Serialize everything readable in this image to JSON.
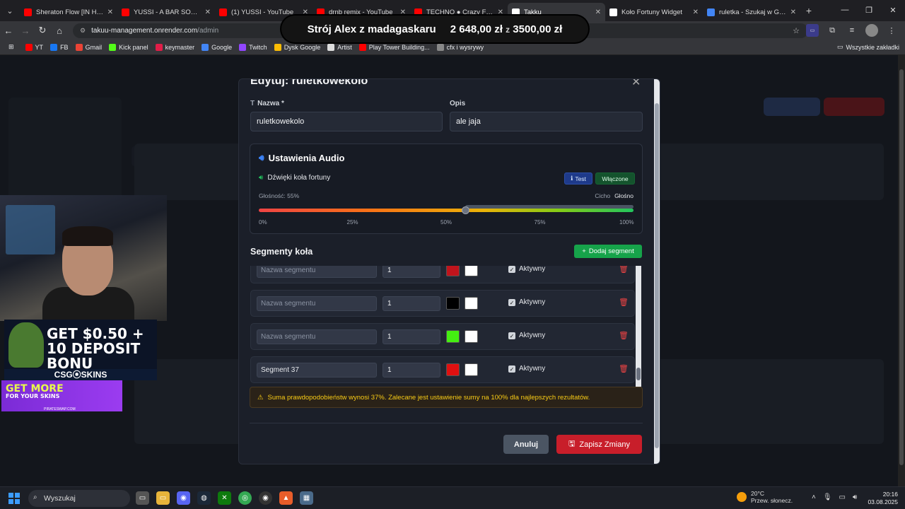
{
  "tabs": [
    {
      "title": "Sheraton Flow [IN HAJS W",
      "color": "#ff0000"
    },
    {
      "title": "YUSSI - A BAR SONG (TIP",
      "color": "#ff0000"
    },
    {
      "title": "(1) YUSSI - YouTube",
      "color": "#ff0000"
    },
    {
      "title": "drnb remix - YouTube",
      "color": "#ff0000"
    },
    {
      "title": "TECHNO ● Crazy Frog - A",
      "color": "#ff0000"
    },
    {
      "title": "Takku",
      "color": "#ffffff",
      "active": true
    },
    {
      "title": "Koło Fortuny Widget",
      "color": "#ffffff"
    },
    {
      "title": "ruletka - Szukaj w Google",
      "color": "#4285f4"
    }
  ],
  "address": {
    "host": "takuu-management.onrender.com",
    "path": "/admin"
  },
  "bookmarks": [
    {
      "label": "YT",
      "color": "#ff0000"
    },
    {
      "label": "FB",
      "color": "#1877f2"
    },
    {
      "label": "Gmail",
      "color": "#ea4335"
    },
    {
      "label": "Kick panel",
      "color": "#53fc18"
    },
    {
      "label": "keymaster",
      "color": "#e11d48"
    },
    {
      "label": "Google",
      "color": "#4285f4"
    },
    {
      "label": "Twitch",
      "color": "#9146ff"
    },
    {
      "label": "Dysk Google",
      "color": "#fbbc04"
    },
    {
      "label": "Artist",
      "color": "#dddddd"
    },
    {
      "label": "Play Tower Building...",
      "color": "#ff0000"
    },
    {
      "label": "cfx i wysrywy",
      "color": "#888888"
    }
  ],
  "bookmarks_all": "Wszystkie zakładki",
  "banner": {
    "title": "Strój Alex z madagaskaru",
    "current": "2 648,00 zł",
    "sep": "z",
    "goal": "3500,00 zł"
  },
  "ads": {
    "ad1_text": "GET $0.50 + 10 DEPOSIT BONU",
    "ad1_brand": "CSG⦿SKINS",
    "ad2_text": "GET MORE",
    "ad2_sub": "FOR YOUR SKINS",
    "ad2_small": "PIRATESWAP.COM"
  },
  "modal": {
    "title": "Edytuj: ruletkowekolo",
    "name_label": "Nazwa *",
    "name_value": "ruletkowekolo",
    "desc_label": "Opis",
    "desc_value": "ale jaja",
    "audio": {
      "title": "Ustawienia Audio",
      "sound_label": "Dźwięki koła fortuny",
      "test_label": "Test",
      "enabled_label": "Włączone",
      "volume_label": "Głośność: 55%",
      "volume": 0.55,
      "quiet_label": "Cicho",
      "loud_label": "Głośno",
      "ticks": [
        "0%",
        "25%",
        "50%",
        "75%",
        "100%"
      ]
    },
    "segments_title": "Segmenty koła",
    "add_segment": "Dodaj segment",
    "segments": [
      {
        "name": "",
        "placeholder": "Nazwa segmentu",
        "weight": "1",
        "color": "#c0141c",
        "text_color": "#ffffff",
        "active_label": "Aktywny"
      },
      {
        "name": "",
        "placeholder": "Nazwa segmentu",
        "weight": "1",
        "color": "#000000",
        "text_color": "#ffffff",
        "active_label": "Aktywny"
      },
      {
        "name": "",
        "placeholder": "Nazwa segmentu",
        "weight": "1",
        "color": "#44ee11",
        "text_color": "#ffffff",
        "active_label": "Aktywny"
      },
      {
        "name": "Segment 37",
        "placeholder": "Nazwa segmentu",
        "weight": "1",
        "color": "#e01010",
        "text_color": "#ffffff",
        "active_label": "Aktywny"
      }
    ],
    "warning": "Suma prawdopodobieństw wynosi 37%. Zalecane jest ustawienie sumy na 100% dla najlepszych rezultatów.",
    "cancel_label": "Anuluj",
    "save_label": "Zapisz Zmiany"
  },
  "taskbar": {
    "search_label": "Wyszukaj",
    "weather_temp": "20°C",
    "weather_desc": "Przew. słonecz.",
    "time": "20:16",
    "date": "03.08.2025"
  }
}
